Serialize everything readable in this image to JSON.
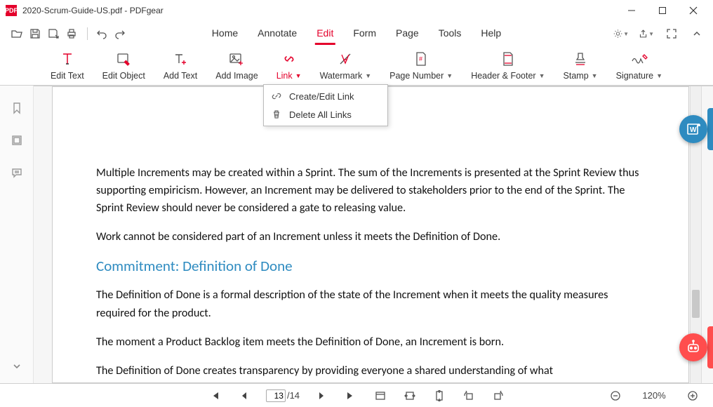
{
  "window": {
    "title": "2020-Scrum-Guide-US.pdf - PDFgear",
    "app_icon_text": "PDF"
  },
  "menu": {
    "tabs": [
      "Home",
      "Annotate",
      "Edit",
      "Form",
      "Page",
      "Tools",
      "Help"
    ],
    "active_index": 2
  },
  "ribbon": {
    "edit_text": "Edit Text",
    "edit_object": "Edit Object",
    "add_text": "Add Text",
    "add_image": "Add Image",
    "link": "Link",
    "watermark": "Watermark",
    "page_number": "Page Number",
    "header_footer": "Header & Footer",
    "stamp": "Stamp",
    "signature": "Signature"
  },
  "link_dropdown": {
    "create_edit": "Create/Edit Link",
    "delete_all": "Delete All Links"
  },
  "document": {
    "para1": "Multiple Increments may be created within a Sprint. The sum of the Increments is presented at the Sprint Review thus supporting empiricism. However, an Increment may be delivered to stakeholders prior to the end of the Sprint. The Sprint Review should never be considered a gate to releasing value.",
    "para2": "Work cannot be considered part of an Increment unless it meets the Definition of Done.",
    "heading": "Commitment: Definition of Done",
    "para3": "The Definition of Done is a formal description of the state of the Increment when it meets the quality measures required for the product.",
    "para4": "The moment a Product Backlog item meets the Definition of Done, an Increment is born.",
    "para5": "The Definition of Done creates transparency by providing everyone a shared understanding of what"
  },
  "status": {
    "page_current": "13",
    "page_total": "/14",
    "zoom": "120%"
  }
}
